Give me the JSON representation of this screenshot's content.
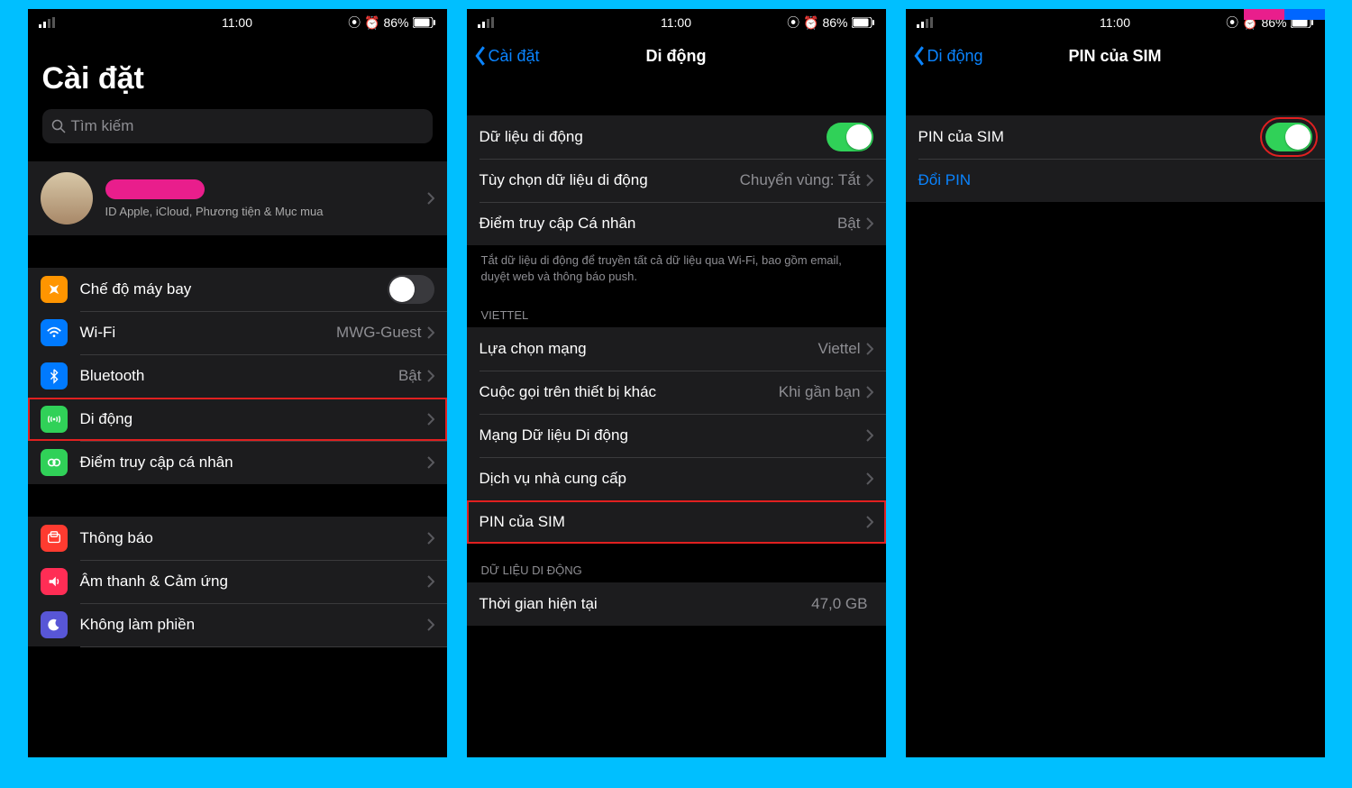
{
  "status": {
    "time": "11:00",
    "battery": "86%"
  },
  "screen1": {
    "title": "Cài đặt",
    "search_placeholder": "Tìm kiếm",
    "profile_sub": "ID Apple, iCloud, Phương tiện & Mục mua",
    "rows": {
      "airplane": "Chế độ máy bay",
      "wifi": "Wi-Fi",
      "wifi_value": "MWG-Guest",
      "bluetooth": "Bluetooth",
      "bluetooth_value": "Bật",
      "cellular": "Di động",
      "hotspot": "Điểm truy cập cá nhân",
      "notifications": "Thông báo",
      "sounds": "Âm thanh & Cảm ứng",
      "dnd": "Không làm phiền"
    }
  },
  "screen2": {
    "back": "Cài đặt",
    "title": "Di động",
    "rows": {
      "data": "Dữ liệu di động",
      "options": "Tùy chọn dữ liệu di động",
      "options_value": "Chuyển vùng: Tắt",
      "hotspot": "Điểm truy cập Cá nhân",
      "hotspot_value": "Bật",
      "footer1": "Tắt dữ liệu di động để truyền tất cả dữ liệu qua Wi-Fi, bao gồm email, duyệt web và thông báo push.",
      "carrier_header": "VIETTEL",
      "network": "Lựa chọn mạng",
      "network_value": "Viettel",
      "calls": "Cuộc gọi trên thiết bị khác",
      "calls_value": "Khi gần bạn",
      "datanet": "Mạng Dữ liệu Di động",
      "services": "Dịch vụ nhà cung cấp",
      "simpin": "PIN của SIM",
      "usage_header": "DỮ LIỆU DI ĐỘNG",
      "current": "Thời gian hiện tại",
      "current_value": "47,0 GB"
    }
  },
  "screen3": {
    "back": "Di động",
    "title": "PIN của SIM",
    "rows": {
      "simpin": "PIN của SIM",
      "change": "Đổi PIN"
    }
  }
}
